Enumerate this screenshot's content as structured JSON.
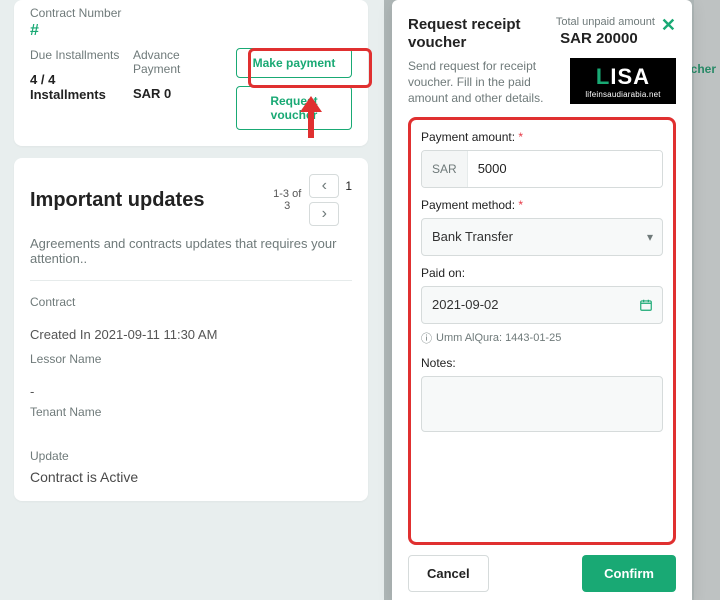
{
  "contract_card": {
    "contract_number_label": "Contract Number",
    "contract_number_value": "#",
    "due_label": "Due Installments",
    "due_value": "4 / 4 Installments",
    "advance_label": "Advance Payment",
    "advance_value": "SAR 0",
    "make_payment": "Make payment",
    "request_voucher": "Request voucher"
  },
  "updates": {
    "title": "Important updates",
    "pager_from": "1-3",
    "pager_of": "of",
    "pager_total": "3",
    "pager_current": "1",
    "subtitle": "Agreements and contracts updates that requires your attention..",
    "contract_label": "Contract",
    "created_in": "Created In 2021-09-11 11:30 AM",
    "lessor_label": "Lessor Name",
    "lessor_value": "-",
    "tenant_label": "Tenant Name",
    "update_label": "Update",
    "update_value": "Contract is Active"
  },
  "modal": {
    "title": "Request receipt voucher",
    "total_unpaid_label": "Total unpaid amount",
    "total_unpaid_value": "SAR 20000",
    "desc": "Send request for receipt voucher. Fill in the paid amount and other details.",
    "logo_text": "ISA",
    "logo_sub": "lifeinsaudiarabia.net",
    "payment_amount_label": "Payment amount:",
    "currency_prefix": "SAR",
    "payment_amount_value": "5000",
    "payment_method_label": "Payment method:",
    "payment_method_value": "Bank Transfer",
    "paid_on_label": "Paid on:",
    "paid_on_value": "2021-09-02",
    "hijri_hint": "Umm AlQura: 1443-01-25",
    "notes_label": "Notes:",
    "notes_value": "",
    "cancel": "Cancel",
    "confirm": "Confirm"
  },
  "edge_hint": "cher"
}
